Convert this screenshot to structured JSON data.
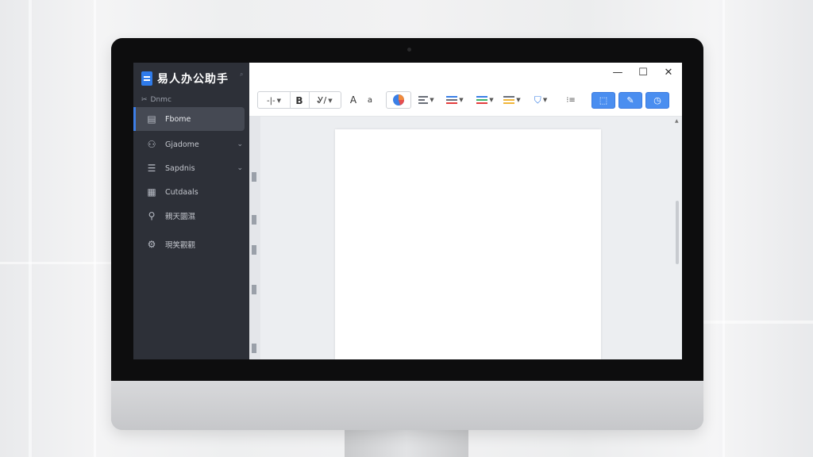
{
  "app": {
    "title": "易人办公助手",
    "section_label": "Dnmc"
  },
  "sidebar": {
    "items": [
      {
        "label": "Fbome",
        "icon": "document-icon",
        "active": true,
        "expandable": false
      },
      {
        "label": "Gjadome",
        "icon": "users-icon",
        "active": false,
        "expandable": true
      },
      {
        "label": "Sapdnis",
        "icon": "list-icon",
        "active": false,
        "expandable": true
      },
      {
        "label": "Cutdaals",
        "icon": "file-grid-icon",
        "active": false,
        "expandable": false
      },
      {
        "label": "親天圜濕",
        "icon": "user-search-icon",
        "active": false,
        "expandable": false
      },
      {
        "label": "現笑觀觀",
        "icon": "gear-icon",
        "active": false,
        "expandable": false
      }
    ]
  },
  "window_controls": {
    "minimize": "—",
    "maximize": "☐",
    "close": "✕"
  },
  "toolbar": {
    "format_group": {
      "align": "-|-",
      "bold": "B",
      "strike": "Ꮍ/"
    },
    "font_size": "A",
    "font_color": "a",
    "accent_color": "#4a8ef0"
  },
  "colors": {
    "sidebar_bg": "#2d3038",
    "active_item_bg": "#454953",
    "accent_blue": "#3d7ee6",
    "bezel": "#0d0d0e"
  }
}
